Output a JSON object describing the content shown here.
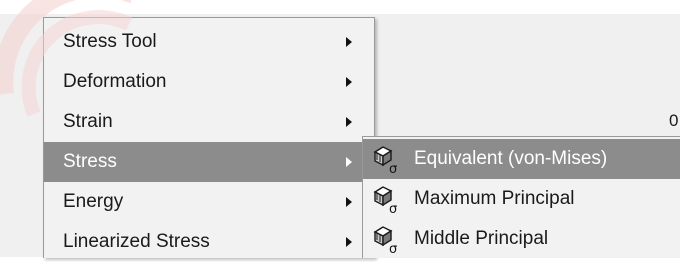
{
  "background": {
    "readout": "0"
  },
  "main_menu": {
    "items": [
      {
        "label": "Stress Tool",
        "icon": "chevron-right-icon",
        "highlighted": false
      },
      {
        "label": "Deformation",
        "icon": "chevron-right-icon",
        "highlighted": false
      },
      {
        "label": "Strain",
        "icon": "chevron-right-icon",
        "highlighted": false
      },
      {
        "label": "Stress",
        "icon": "chevron-right-icon",
        "highlighted": true
      },
      {
        "label": "Energy",
        "icon": "chevron-right-icon",
        "highlighted": false
      },
      {
        "label": "Linearized Stress",
        "icon": "chevron-right-icon",
        "highlighted": false
      }
    ]
  },
  "submenu": {
    "items": [
      {
        "label": "Equivalent (von-Mises)",
        "icon": "stress-result-icon",
        "highlighted": true
      },
      {
        "label": "Maximum Principal",
        "icon": "stress-result-icon",
        "highlighted": false
      },
      {
        "label": "Middle Principal",
        "icon": "stress-result-icon",
        "highlighted": false
      }
    ]
  },
  "icon_symbol": "σ",
  "colors": {
    "highlight": "#8c8c8c",
    "menu_bg": "#f2f2f2",
    "watermark": "#f5d2d2"
  }
}
